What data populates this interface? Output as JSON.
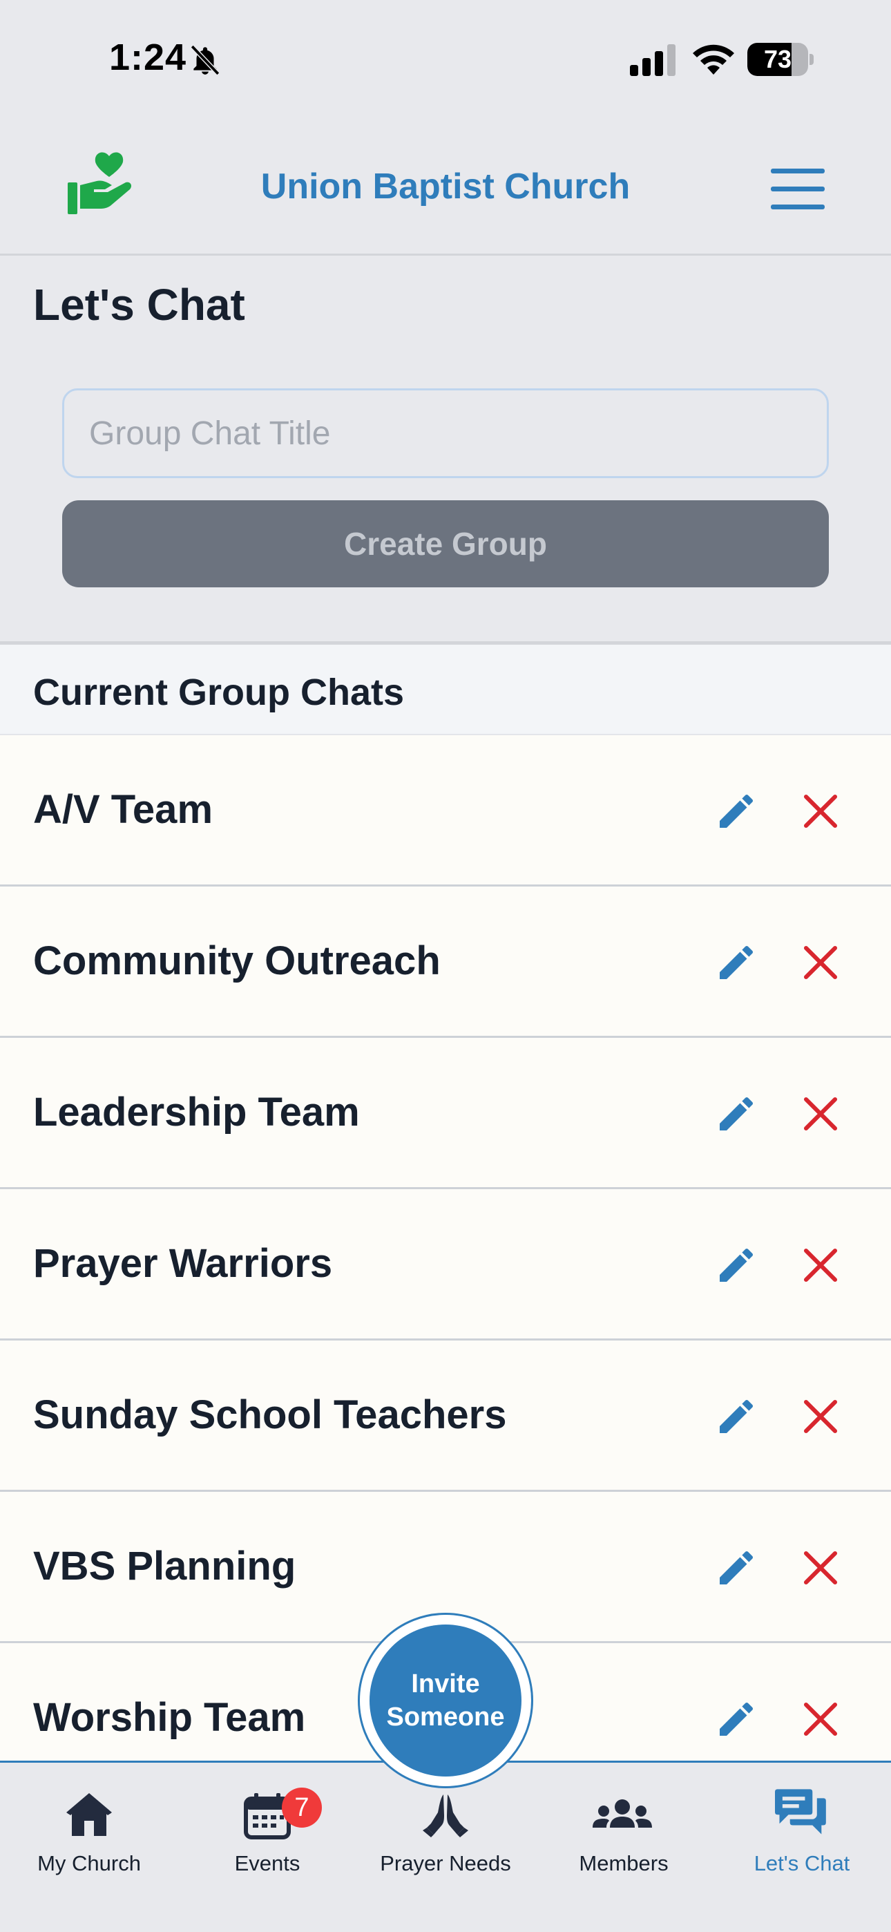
{
  "status_bar": {
    "time": "1:24",
    "battery": "73",
    "battery_level": 0.73
  },
  "header": {
    "church_name": "Union Baptist Church",
    "logo_icon": "heart-hand-icon",
    "menu_icon": "hamburger-menu-icon"
  },
  "create_chat": {
    "title": "Let's Chat",
    "input_placeholder": "Group Chat Title",
    "input_value": "",
    "create_button_label": "Create Group"
  },
  "group_chats": {
    "section_title": "Current Group Chats",
    "items": [
      {
        "name": "A/V Team"
      },
      {
        "name": "Community Outreach"
      },
      {
        "name": "Leadership Team"
      },
      {
        "name": "Prayer Warriors"
      },
      {
        "name": "Sunday School Teachers"
      },
      {
        "name": "VBS Planning"
      },
      {
        "name": "Worship Team"
      }
    ],
    "edit_icon": "pencil-icon",
    "delete_icon": "x-icon"
  },
  "invite": {
    "line1": "Invite",
    "line2": "Someone"
  },
  "bottom_nav": {
    "items": [
      {
        "label": "My Church",
        "icon": "home-icon"
      },
      {
        "label": "Events",
        "icon": "calendar-icon",
        "badge": "7"
      },
      {
        "label": "Prayer Needs",
        "icon": "praying-hands-icon"
      },
      {
        "label": "Members",
        "icon": "people-icon"
      },
      {
        "label": "Let's Chat",
        "icon": "chat-bubbles-icon",
        "active": true
      }
    ]
  },
  "colors": {
    "brand_blue": "#2F7DBB",
    "logo_green": "#1FA84A",
    "delete_red": "#D8262E",
    "badge_red": "#F03A3A",
    "disabled_button": "#6C737F"
  }
}
